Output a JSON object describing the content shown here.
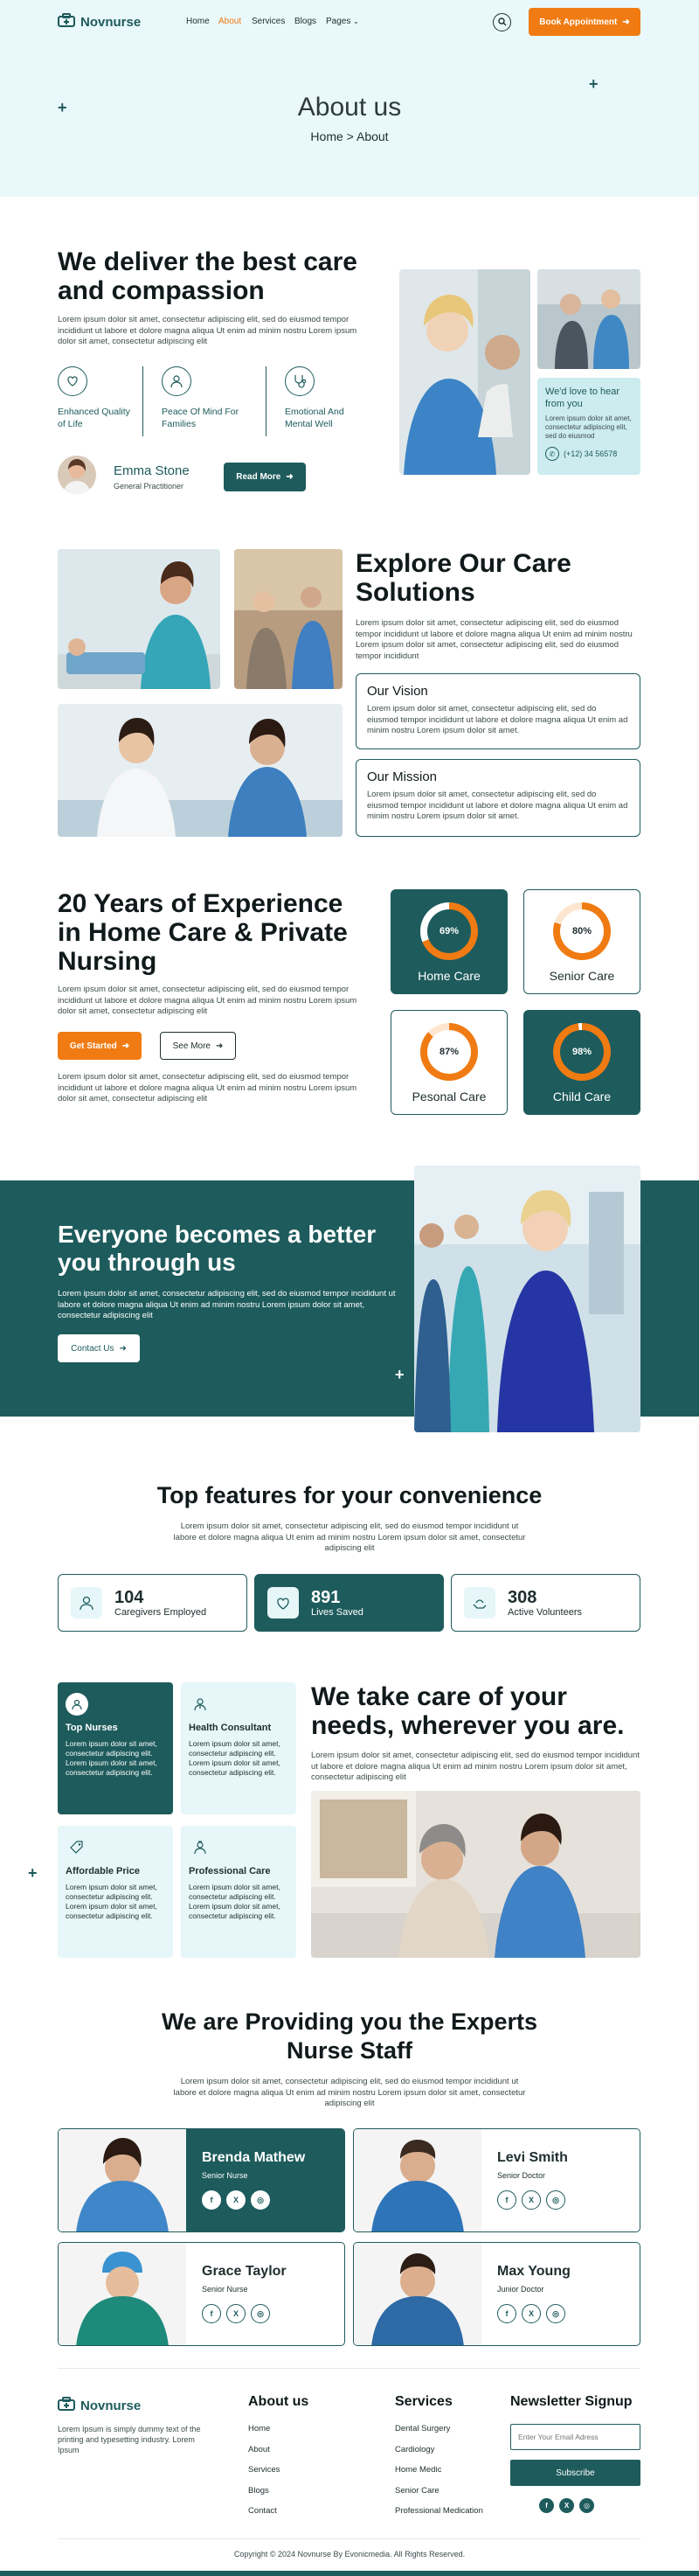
{
  "header": {
    "logo_text": "Novnurse",
    "nav": [
      "Home",
      "About",
      "Services",
      "Blogs",
      "Pages"
    ],
    "active_nav": "About",
    "cta": "Book Appointment"
  },
  "hero": {
    "title": "About us",
    "breadcrumb_home": "Home",
    "breadcrumb_sep": ">",
    "breadcrumb_current": "About"
  },
  "intro": {
    "title": "We deliver the best care and compassion",
    "text": "Lorem ipsum dolor sit amet, consectetur adipiscing elit, sed do eiusmod tempor incididunt ut labore et dolore magna aliqua Ut enim ad minim nostru Lorem ipsum dolor sit amet, consectetur adipiscing elit",
    "features": [
      "Enhanced Quality of Life",
      "Peace Of Mind For Families",
      "Emotional And Mental Well"
    ],
    "person_name": "Emma Stone",
    "person_role": "General Practitioner",
    "read_more": "Read More",
    "hear_title": "We'd love to hear from you",
    "hear_text": "Lorem ipsum dolor sit amet, consectetur adipiscing elit, sed do eiusmod",
    "phone": "(+12) 34 56578"
  },
  "explore": {
    "title": "Explore Our Care Solutions",
    "text": "Lorem ipsum dolor sit amet, consectetur adipiscing elit, sed do eiusmod tempor incididunt ut labore et dolore magna aliqua Ut enim ad minim nostru Lorem ipsum dolor sit amet, consectetur adipiscing elit, sed do eiusmod tempor incididunt",
    "vision_title": "Our Vision",
    "vision_text": "Lorem ipsum dolor sit amet, consectetur adipiscing elit, sed do eiusmod tempor incididunt ut labore et dolore magna aliqua Ut enim ad minim nostru Lorem ipsum dolor sit amet.",
    "mission_title": "Our Mission",
    "mission_text": "Lorem ipsum dolor sit amet, consectetur adipiscing elit, sed do eiusmod tempor incididunt ut labore et dolore magna aliqua Ut enim ad minim nostru Lorem ipsum dolor sit amet."
  },
  "experience": {
    "title": "20 Years of Experience in Home Care & Private Nursing",
    "text1": "Lorem ipsum dolor sit amet, consectetur adipiscing elit, sed do eiusmod tempor incididunt ut labore et dolore magna aliqua Ut enim ad minim nostru Lorem ipsum dolor sit amet, consectetur adipiscing elit",
    "get_started": "Get Started",
    "see_more": "See More",
    "text2": "Lorem ipsum dolor sit amet, consectetur adipiscing elit, sed do eiusmod tempor incididunt ut labore et dolore magna aliqua Ut enim ad minim nostru Lorem ipsum dolor sit amet, consectetur adipiscing elit",
    "gauges": [
      {
        "label": "Home Care",
        "value": 69,
        "display": "69%"
      },
      {
        "label": "Senior Care",
        "value": 80,
        "display": "80%"
      },
      {
        "label": "Pesonal Care",
        "value": 87,
        "display": "87%"
      },
      {
        "label": "Child Care",
        "value": 98,
        "display": "98%"
      }
    ]
  },
  "banner": {
    "title": "Everyone becomes a better you through us",
    "text": "Lorem ipsum dolor sit amet, consectetur adipiscing elit, sed do eiusmod tempor incididunt ut labore et dolore magna aliqua Ut enim ad minim nostru Lorem ipsum dolor sit amet, consectetur adipiscing elit",
    "cta": "Contact Us"
  },
  "features": {
    "title": "Top features for your convenience",
    "text": "Lorem ipsum dolor sit amet, consectetur adipiscing elit, sed do eiusmod tempor incididunt ut labore et dolore magna aliqua Ut enim ad minim nostru Lorem ipsum dolor sit amet, consectetur adipiscing elit",
    "stats": [
      {
        "num": "104",
        "label": "Caregivers Employed"
      },
      {
        "num": "891",
        "label": "Lives Saved"
      },
      {
        "num": "308",
        "label": "Active Volunteers"
      }
    ]
  },
  "care": {
    "title": "We take care of your needs, wherever you are.",
    "text": "Lorem ipsum dolor sit amet, consectetur adipiscing elit, sed do eiusmod tempor incididunt ut labore et dolore magna aliqua Ut enim ad minim nostru Lorem ipsum dolor sit amet, consectetur adipiscing elit",
    "services": [
      {
        "title": "Top Nurses",
        "text": "Lorem ipsum dolor sit amet, consectetur adipiscing elit. Lorem ipsum dolor sit amet, consectetur adipiscing elit."
      },
      {
        "title": "Health Consultant",
        "text": "Lorem ipsum dolor sit amet, consectetur adipiscing elit. Lorem ipsum dolor sit amet, consectetur adipiscing elit."
      },
      {
        "title": "Affordable Price",
        "text": "Lorem ipsum dolor sit amet, consectetur adipiscing elit. Lorem ipsum dolor sit amet, consectetur adipiscing elit."
      },
      {
        "title": "Professional Care",
        "text": "Lorem ipsum dolor sit amet, consectetur adipiscing elit. Lorem ipsum dolor sit amet, consectetur adipiscing elit."
      }
    ]
  },
  "staff": {
    "title": "We are Providing you the Experts Nurse Staff",
    "text": "Lorem ipsum dolor sit amet, consectetur adipiscing elit, sed do eiusmod tempor incididunt ut labore et dolore magna aliqua Ut enim ad minim nostru Lorem ipsum dolor sit amet, consectetur adipiscing elit",
    "nurses": [
      {
        "name": "Brenda Mathew",
        "role": "Senior Nurse"
      },
      {
        "name": "Levi Smith",
        "role": "Senior Doctor"
      },
      {
        "name": "Grace Taylor",
        "role": "Senior Nurse"
      },
      {
        "name": "Max Young",
        "role": "Junior Doctor"
      }
    ],
    "social_labels": [
      "f",
      "X",
      "◎"
    ]
  },
  "footer": {
    "logo_text": "Novnurse",
    "about_text": "Lorem Ipsum is simply dummy text of the printing and typesetting industry. Lorem Ipsum",
    "about_title": "About us",
    "about_links": [
      "Home",
      "About",
      "Services",
      "Blogs",
      "Contact"
    ],
    "services_title": "Services",
    "services_links": [
      "Dental Surgery",
      "Cardiology",
      "Home Medic",
      "Senior Care",
      "Professional Medication"
    ],
    "newsletter_title": "Newsletter Signup",
    "email_placeholder": "Enter Your Email Adress",
    "subscribe": "Subscribe",
    "copyright": "Copyright © 2024 Novnurse By Evonicmedia. All Rights Reserved."
  },
  "colors": {
    "teal": "#1e5b5c",
    "orange": "#f07b12",
    "hero_bg": "#e9f8fb",
    "light_card": "#e6f6f9"
  }
}
